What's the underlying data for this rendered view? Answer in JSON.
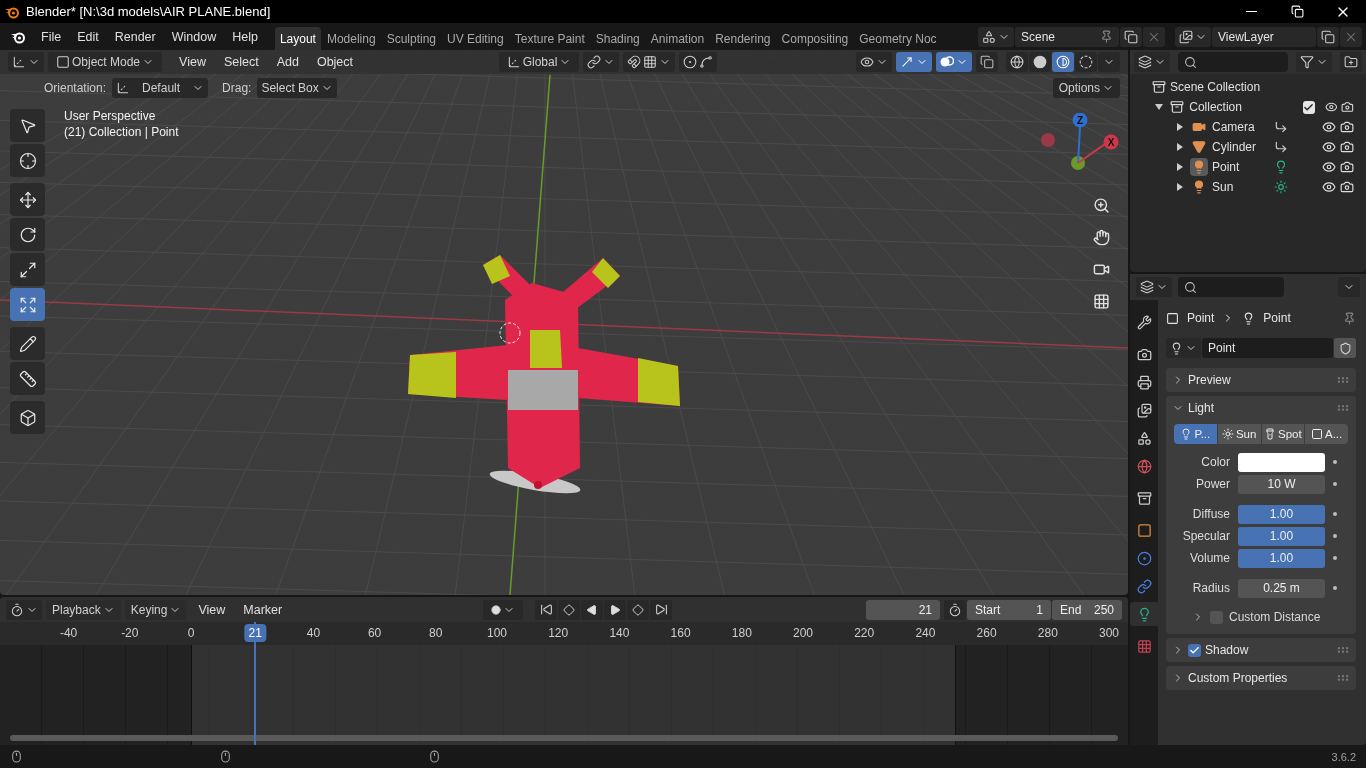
{
  "window": {
    "title": "Blender* [N:\\3d models\\AIR PLANE.blend]"
  },
  "menu": [
    "File",
    "Edit",
    "Render",
    "Window",
    "Help"
  ],
  "workspaces": [
    {
      "label": "Layout",
      "selected": true
    },
    {
      "label": "Modeling",
      "selected": false
    },
    {
      "label": "Sculpting",
      "selected": false
    },
    {
      "label": "UV Editing",
      "selected": false
    },
    {
      "label": "Texture Paint",
      "selected": false
    },
    {
      "label": "Shading",
      "selected": false
    },
    {
      "label": "Animation",
      "selected": false
    },
    {
      "label": "Rendering",
      "selected": false
    },
    {
      "label": "Compositing",
      "selected": false
    },
    {
      "label": "Geometry Noc",
      "selected": false
    }
  ],
  "scene": {
    "name": "Scene"
  },
  "view_layer": {
    "name": "ViewLayer"
  },
  "viewport": {
    "mode": "Object Mode",
    "menu": [
      "View",
      "Select",
      "Add",
      "Object"
    ],
    "orientation": "Global",
    "toggles": [
      {
        "kind": "gizmo",
        "on": true
      },
      {
        "kind": "overlays",
        "on": true
      },
      {
        "kind": "xray",
        "on": false
      }
    ],
    "shading": [
      {
        "kind": "wireframe",
        "selected": false
      },
      {
        "kind": "solid",
        "selected": false
      },
      {
        "kind": "material",
        "selected": true
      },
      {
        "kind": "rendered",
        "selected": false
      }
    ],
    "tool_settings": {
      "orientation_label": "Orientation:",
      "orientation": "Default",
      "drag_label": "Drag:",
      "drag": "Select Box",
      "options": "Options"
    },
    "info": [
      "User Perspective",
      "(21) Collection | Point"
    ],
    "tool_groups": [
      [
        {
          "kind": "select",
          "selected": false
        },
        {
          "kind": "cursor",
          "selected": false
        }
      ],
      [
        {
          "kind": "move",
          "selected": false
        },
        {
          "kind": "rotate",
          "selected": false
        },
        {
          "kind": "scale",
          "selected": false
        },
        {
          "kind": "transform",
          "selected": true
        }
      ],
      [
        {
          "kind": "annotate",
          "selected": false
        },
        {
          "kind": "measure",
          "selected": false
        }
      ],
      [
        {
          "kind": "add_cube",
          "selected": false
        }
      ]
    ],
    "gizmo": {
      "z_label": "Z",
      "x_label": "X"
    }
  },
  "outliner": {
    "root": "Scene Collection",
    "items": [
      {
        "name": "Collection",
        "kind": "collection",
        "expanded": true,
        "checked": true,
        "selected": false,
        "children": [
          {
            "name": "Camera",
            "kind": "camera",
            "expanded": false,
            "selected": false
          },
          {
            "name": "Cylinder",
            "kind": "mesh",
            "expanded": false,
            "selected": false
          },
          {
            "name": "Point",
            "kind": "point_light",
            "expanded": false,
            "selected": true
          },
          {
            "name": "Sun",
            "kind": "sun_light",
            "expanded": false,
            "selected": false
          }
        ]
      }
    ]
  },
  "properties": {
    "tab_groups": [
      [
        {
          "kind": "tool",
          "selected": false
        }
      ],
      [
        {
          "kind": "render",
          "selected": false
        },
        {
          "kind": "output",
          "selected": false
        },
        {
          "kind": "view_layer",
          "selected": false
        },
        {
          "kind": "scene",
          "selected": false
        },
        {
          "kind": "world",
          "selected": false
        }
      ],
      [
        {
          "kind": "collection",
          "selected": false
        }
      ],
      [
        {
          "kind": "object",
          "selected": false
        },
        {
          "kind": "physics",
          "selected": false
        },
        {
          "kind": "constraints",
          "selected": false
        },
        {
          "kind": "data",
          "selected": true
        }
      ],
      [
        {
          "kind": "texture",
          "selected": false
        }
      ]
    ],
    "breadcrumb": [
      "Point",
      "Point"
    ],
    "datablock": "Point",
    "panels": [
      {
        "title": "Preview",
        "expanded": false
      },
      {
        "title": "Light",
        "expanded": true,
        "light_types": [
          {
            "kind": "point",
            "label": "P...",
            "selected": true
          },
          {
            "kind": "sun",
            "label": "Sun",
            "selected": false
          },
          {
            "kind": "spot",
            "label": "Spot",
            "selected": false
          },
          {
            "kind": "area",
            "label": "A...",
            "selected": false
          }
        ],
        "fields": [
          {
            "kind": "color",
            "label": "Color",
            "color": "#ffffff"
          },
          {
            "kind": "value",
            "label": "Power",
            "value": "10 W"
          },
          {
            "kind": "slider",
            "label": "Diffuse",
            "value": "1.00",
            "level": 1
          },
          {
            "kind": "slider",
            "label": "Specular",
            "value": "1.00",
            "level": 1
          },
          {
            "kind": "slider",
            "label": "Volume",
            "value": "1.00",
            "level": 1
          },
          {
            "kind": "value",
            "label": "Radius",
            "value": "0.25 m"
          }
        ],
        "sub": {
          "title": "Custom Distance",
          "checked": false,
          "expanded": false
        }
      },
      {
        "title": "Shadow",
        "expanded": false,
        "checked": true
      },
      {
        "title": "Custom Properties",
        "expanded": false
      }
    ]
  },
  "timeline": {
    "menu": [
      {
        "label": "Playback",
        "dropdown": true
      },
      {
        "label": "Keying",
        "dropdown": true
      },
      {
        "label": "View",
        "dropdown": false
      },
      {
        "label": "Marker",
        "dropdown": false
      }
    ],
    "current_frame": "21",
    "playhead_label": "21",
    "start_label": "Start",
    "start": "1",
    "end_label": "End",
    "end": "250",
    "ruler": [
      "-40",
      "-20",
      "0",
      "40",
      "60",
      "80",
      "100",
      "120",
      "140",
      "160",
      "180",
      "200",
      "220",
      "240",
      "260",
      "280",
      "300"
    ]
  },
  "status_bar": {
    "version": "3.6.2"
  }
}
